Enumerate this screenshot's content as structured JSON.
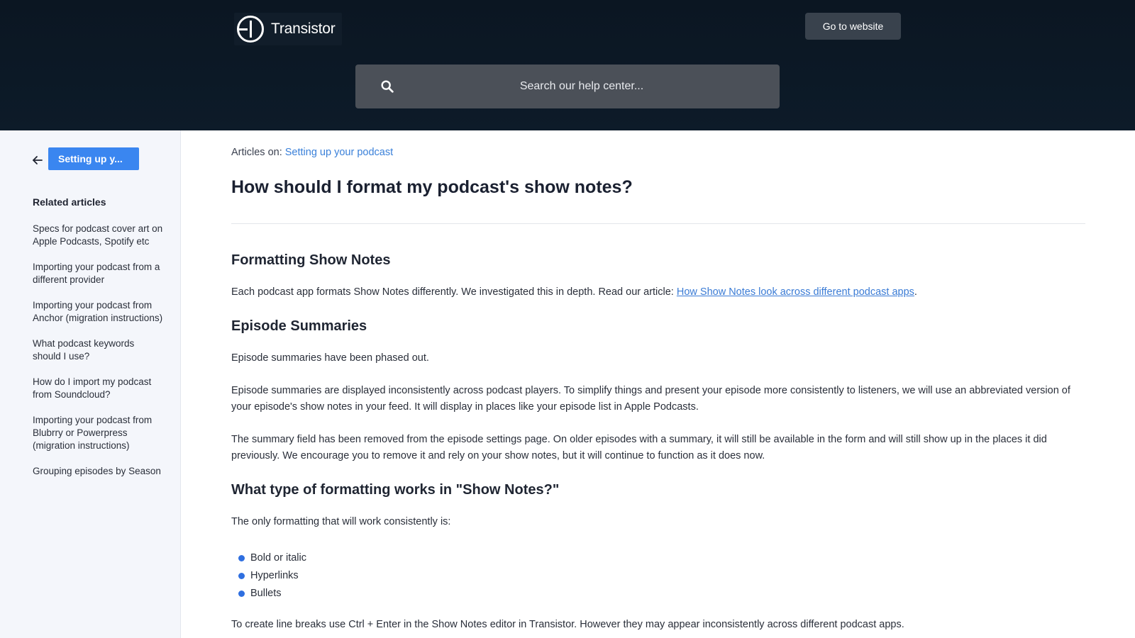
{
  "header": {
    "logo_text": "Transistor",
    "go_website_label": "Go to website",
    "search": {
      "placeholder": "Search our help center..."
    }
  },
  "sidebar": {
    "category_chip": "Setting up y...",
    "related_title": "Related articles",
    "related": [
      "Specs for podcast cover art on Apple Podcasts, Spotify etc",
      "Importing your podcast from a different provider",
      "Importing your podcast from Anchor (migration instructions)",
      "What podcast keywords should I use?",
      "How do I import my podcast from Soundcloud?",
      "Importing your podcast from Blubrry or Powerpress (migration instructions)",
      "Grouping episodes by Season"
    ]
  },
  "article": {
    "breadcrumb_prefix": "Articles on: ",
    "breadcrumb_link": "Setting up your podcast",
    "title": "How should I format my podcast's show notes?",
    "section1_heading": "Formatting Show Notes",
    "section1_text": "Each podcast app formats Show Notes differently. We investigated this in depth. Read our article: ",
    "section1_link": "How Show Notes look across different podcast apps",
    "section1_end": ".",
    "section2_heading": "Episode Summaries",
    "section2_p1": "Episode summaries have been phased out.",
    "section2_p2": "Episode summaries are displayed inconsistently across podcast players. To simplify things and present your episode more consistently to listeners, we will use an abbreviated version of your episode's show notes in your feed. It will display in places like your episode list in Apple Podcasts.",
    "section2_p3": "The summary field has been removed from the episode settings page. On older episodes with a summary, it will still be available in the form and will still show up in the places it did previously. We encourage you to remove it and rely on your show notes, but it will continue to function as it does now.",
    "section3_heading": "What type of formatting works in \"Show Notes?\"",
    "section3_p1": "The only formatting that will work consistently is:",
    "bullets": [
      "Bold or italic",
      "Hyperlinks",
      "Bullets"
    ],
    "section3_p2": "To create line breaks use Ctrl + Enter in the Show Notes editor in Transistor. However they may appear inconsistently across different podcast apps."
  },
  "colors": {
    "header_bg": "#0b1622",
    "accent_blue": "#3a86f0",
    "link_blue": "#3a7bd5",
    "sidebar_bg": "#f4f6fb"
  },
  "icons": [
    "transistor-logo-icon",
    "search-icon",
    "arrow-left-icon",
    "bullet-dot-icon"
  ]
}
